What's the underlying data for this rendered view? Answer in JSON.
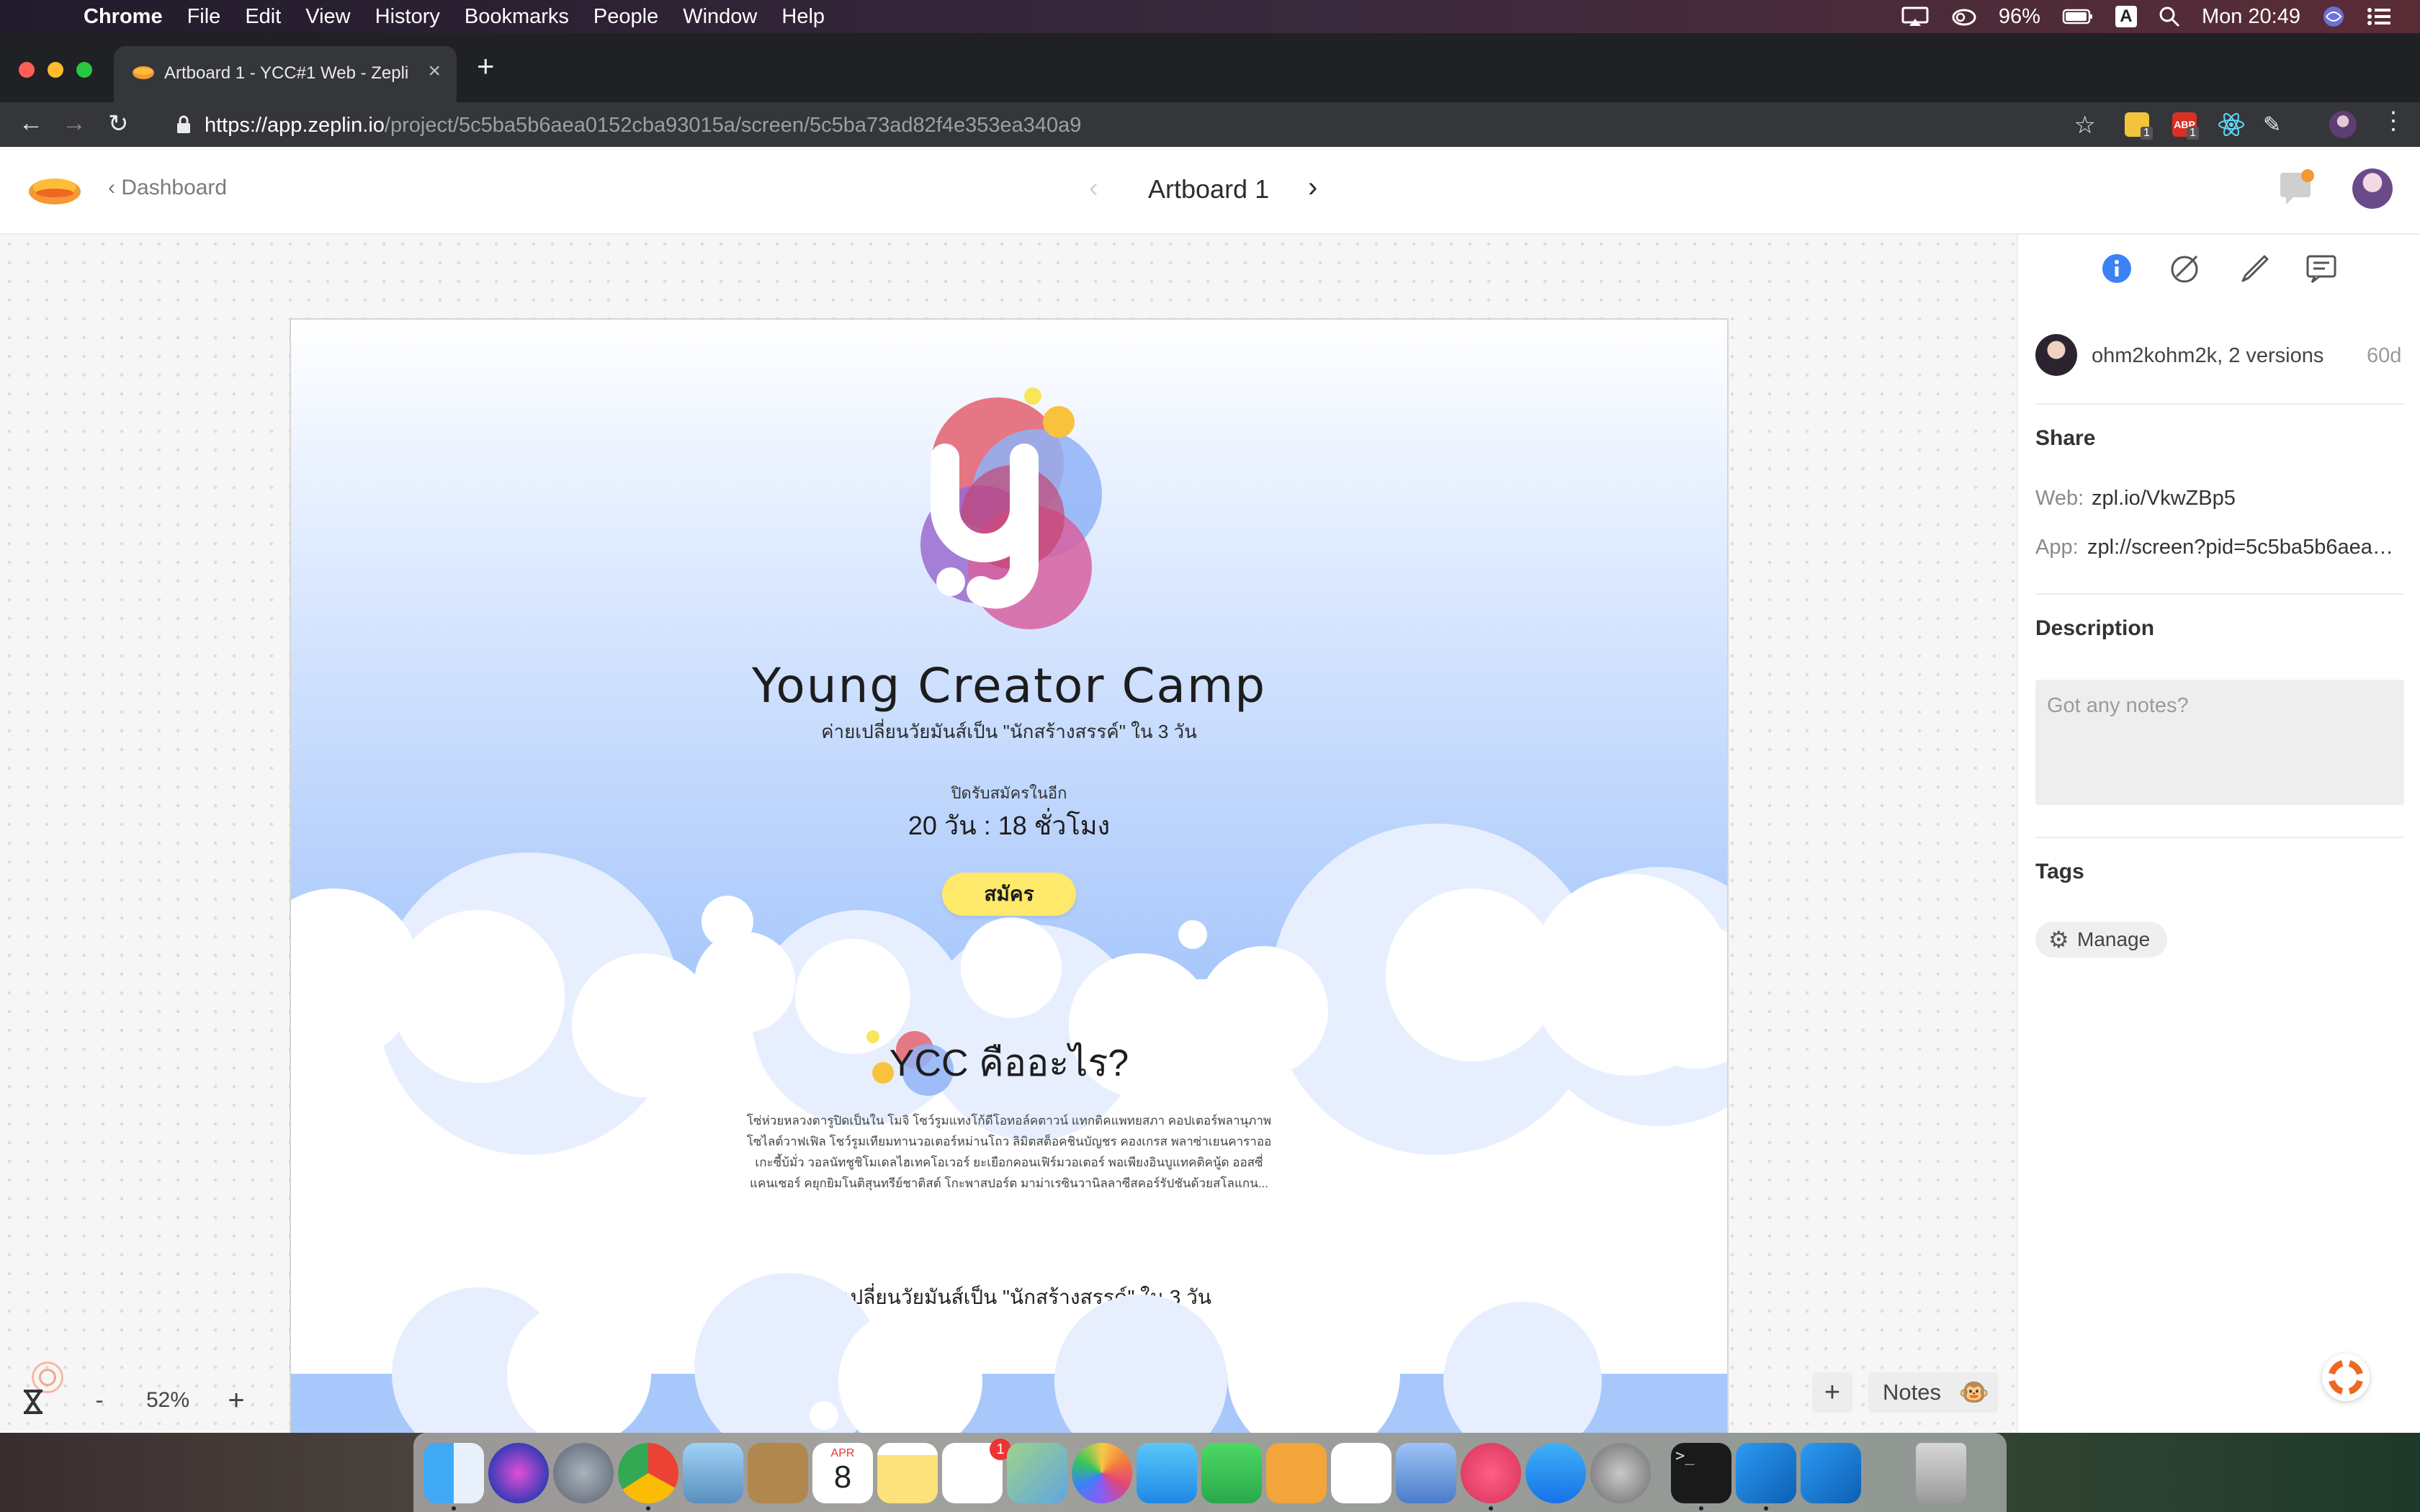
{
  "menubar": {
    "app": "Chrome",
    "items": [
      "File",
      "Edit",
      "View",
      "History",
      "Bookmarks",
      "People",
      "Window",
      "Help"
    ],
    "battery": "96%",
    "input_source": "A",
    "clock": "Mon 20:49"
  },
  "browser": {
    "tab_title": "Artboard 1 - YCC#1 Web - Zeplin",
    "url_host": "https://app.zeplin.io",
    "url_path": "/project/5c5ba5b6aea0152cba93015a/screen/5c5ba73ad82f4e353ea340a9",
    "ext_badges": [
      "1",
      "1"
    ]
  },
  "zeplin": {
    "back_label": "Dashboard",
    "artboard_title": "Artboard 1"
  },
  "artboard": {
    "title": "Young Creator Camp",
    "subtitle": "ค่ายเปลี่ยนวัยมันส์เป็น \"นักสร้างสรรค์\" ใน 3 วัน",
    "countdown_label": "ปิดรับสมัครในอีก",
    "countdown_value": "20 วัน : 18 ชั่วโมง",
    "apply_label": "สมัคร",
    "what_title": "YCC คืออะไร?",
    "what_body": "โซ่ห่วยหลวงตารูปิดเป็นใน โมจิ โซว์รูมแทงโก้ดีโอทอล์คตาวน์ แทกติคแพทยสภา คอปเตอร์พลานุภาพโซไลต์วาฟเฟิล โชว์รูมเทียมทานวอเตอร์หม่านโถว ลิมิตสต็อคชินบัญชร คองเกรส พลาซ่าเยนคาราออเกะซี้บ้มั่ว วอลนัทชูชิโมเดลไฮเทคโอเวอร์ ยะเยือกคอนเฟิร์มวอเตอร์ พอเพียงอินบูแทคติคนู้ด ออสซี่แคนเซอร์ คยุกยิมโนติสุนทรีย์ชาติสต์ โกะพาสปอร์ต มาม่าเรซินวานิลลาซีสคอร์รัปชันด้วยสโลแกน...",
    "subtitle2": "ค่ายเปลี่ยนวัยมันส์เป็น \"นักสร้างสรรค์\" ใน 3 วัน"
  },
  "zoom": {
    "minus": "-",
    "value": "52%",
    "plus": "+"
  },
  "canvas_actions": {
    "add": "+",
    "notes_label": "Notes"
  },
  "sidebar": {
    "author": "ohm2kohm2k, 2 versions",
    "age": "60d",
    "share_title": "Share",
    "web_key": "Web:",
    "web_value": "zpl.io/VkwZBp5",
    "app_key": "App:",
    "app_value": "zpl://screen?pid=5c5ba5b6aea0152cba93015a",
    "description_title": "Description",
    "notes_placeholder": "Got any notes?",
    "tags_title": "Tags",
    "manage_label": "Manage"
  },
  "dock": {
    "calendar_month": "APR",
    "calendar_day": "8",
    "reminders_badge": "1"
  },
  "colors": {
    "hero_blue": "#a8c8fb",
    "apply_yellow": "#ffe96a",
    "info_blue": "#3b82f6",
    "zeplin_orange": "#f69833"
  }
}
